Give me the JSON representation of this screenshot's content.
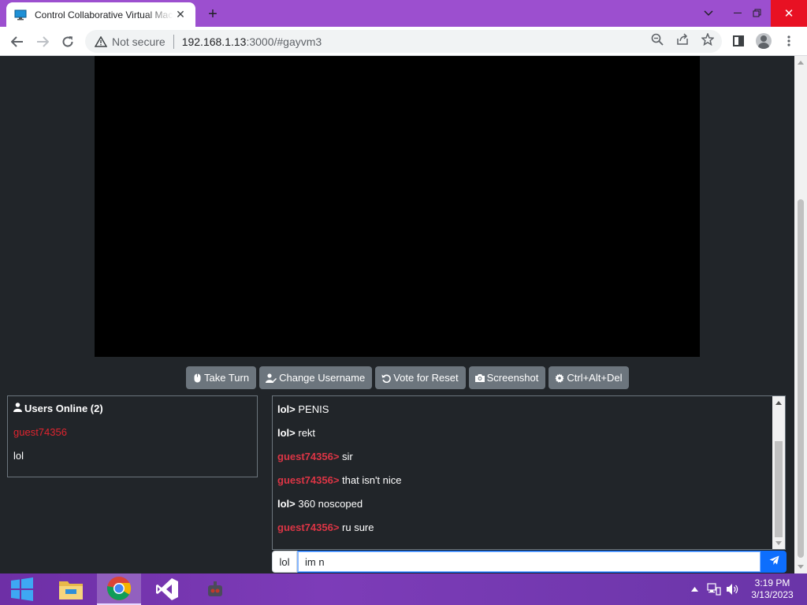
{
  "browser": {
    "tab_title": "Control Collaborative Virtual Machine!",
    "new_tab_icon": "plus-icon",
    "window_controls": [
      "chevron-down-icon",
      "minimize-icon",
      "restore-icon",
      "close-icon"
    ],
    "security_label": "Not secure",
    "url_host": "192.168.1.13",
    "url_rest": ":3000/#gayvm3"
  },
  "buttons": {
    "take_turn": "Take Turn",
    "change_username": "Change Username",
    "vote_reset": "Vote for Reset",
    "screenshot": "Screenshot",
    "ctrl_alt_del": "Ctrl+Alt+Del"
  },
  "users": {
    "header": "Users Online (2)",
    "list": [
      {
        "name": "guest74356",
        "color": "#e0242f"
      },
      {
        "name": "lol",
        "color": "#ffffff"
      }
    ]
  },
  "chat": {
    "messages": [
      {
        "user": "lol>",
        "text": " PENIS"
      },
      {
        "user": "lol>",
        "text": " rekt"
      },
      {
        "user": "guest74356>",
        "text": " sir"
      },
      {
        "user": "guest74356>",
        "text": " that isn't nice"
      },
      {
        "user": "lol>",
        "text": " 360 noscoped"
      },
      {
        "user": "guest74356>",
        "text": " ru sure"
      }
    ],
    "username_badge": "lol",
    "input_value": "im n"
  },
  "taskbar": {
    "apps": [
      "windows-start-icon",
      "file-explorer-icon",
      "chrome-icon",
      "visual-studio-icon",
      "app-icon"
    ],
    "time": "3:19 PM",
    "date": "3/13/2023"
  },
  "colors": {
    "tab_strip": "#9c4fcf",
    "page_bg": "#212529",
    "button_gray": "#6c757d",
    "guest_red": "#dc3545",
    "send_blue": "#0d6efd"
  }
}
